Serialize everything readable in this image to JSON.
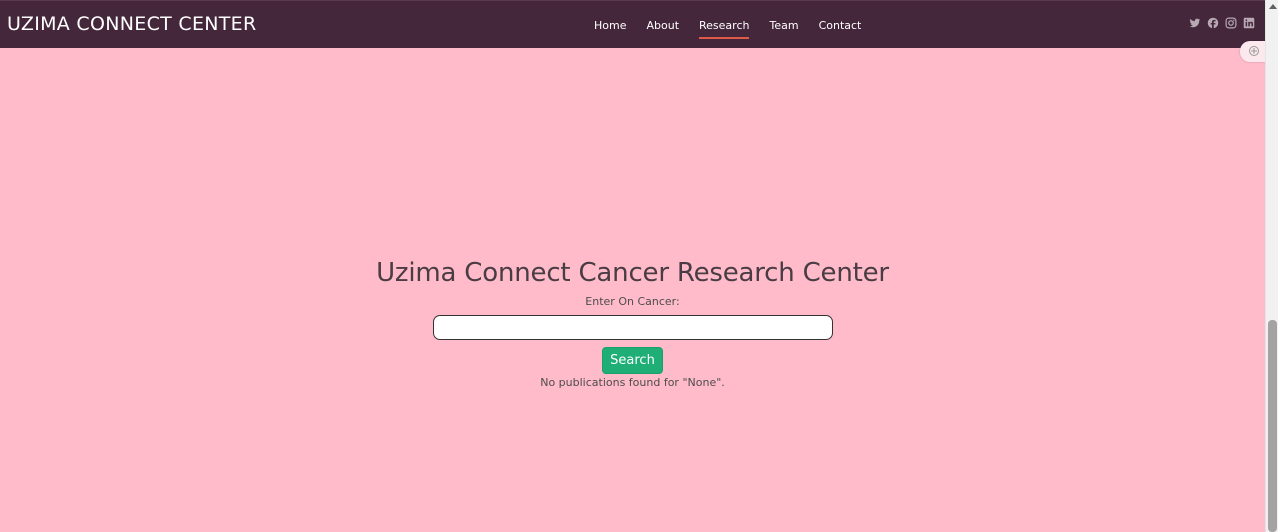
{
  "header": {
    "logo": "UZIMA CONNECT CENTER",
    "nav": [
      {
        "label": "Home",
        "active": false
      },
      {
        "label": "About",
        "active": false
      },
      {
        "label": "Research",
        "active": true
      },
      {
        "label": "Team",
        "active": false
      },
      {
        "label": "Contact",
        "active": false
      }
    ],
    "social_icons": [
      "twitter-icon",
      "facebook-icon",
      "instagram-icon",
      "linkedin-icon"
    ]
  },
  "main": {
    "title": "Uzima Connect Cancer Research Center",
    "search_label": "Enter On Cancer:",
    "search_value": "",
    "search_button": "Search",
    "result_text": "No publications found for \"None\"."
  },
  "colors": {
    "background": "#ffbbc9",
    "header": "#45273c",
    "button": "#1eae76",
    "active_underline": "#e05a4a"
  }
}
